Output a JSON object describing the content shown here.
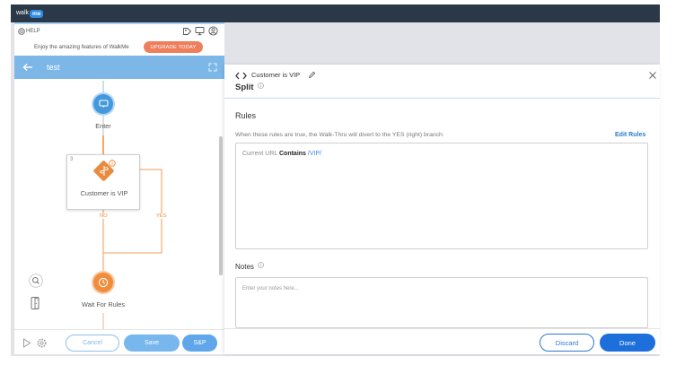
{
  "app": {
    "logo_text": "walk",
    "logo_badge": "me"
  },
  "left_panel": {
    "help_label": "HELP",
    "header_icons": [
      "tag-icon",
      "monitor-icon",
      "user-icon"
    ],
    "promo_text": "Enjoy the amazing features of WalkMe",
    "upgrade_label": "UPGRADE TODAY",
    "flow_title": "test",
    "nodes": {
      "enter_label": "Enter",
      "split_step_number": "3",
      "split_label": "Customer is VIP",
      "no_label": "NO",
      "yes_label": "YES",
      "wait_label": "Wait For Rules"
    },
    "toolbar": {
      "cancel_label": "Cancel",
      "save_label": "Save",
      "sp_label": "S&P"
    }
  },
  "detail_panel": {
    "breadcrumb_title": "Customer is VIP",
    "step_type": "Split",
    "rules_heading": "Rules",
    "rules_description": "When these rules are true, the Walk-Thru will divert to the YES (right) branch:",
    "edit_rules_label": "Edit Rules",
    "rule": {
      "field": "Current URL",
      "operator": "Contains",
      "value": "/VIP/"
    },
    "notes_heading": "Notes",
    "notes_placeholder": "Enter your notes here...",
    "discard_label": "Discard",
    "done_label": "Done"
  },
  "colors": {
    "topbar": "#2b3848",
    "flow_header": "#7cb7e8",
    "upgrade": "#ee7e5c",
    "flow_orange": "#ef8a36",
    "enter_blue": "#4598dc",
    "primary_blue": "#1d6fdb",
    "link_blue": "#2d78c8"
  }
}
